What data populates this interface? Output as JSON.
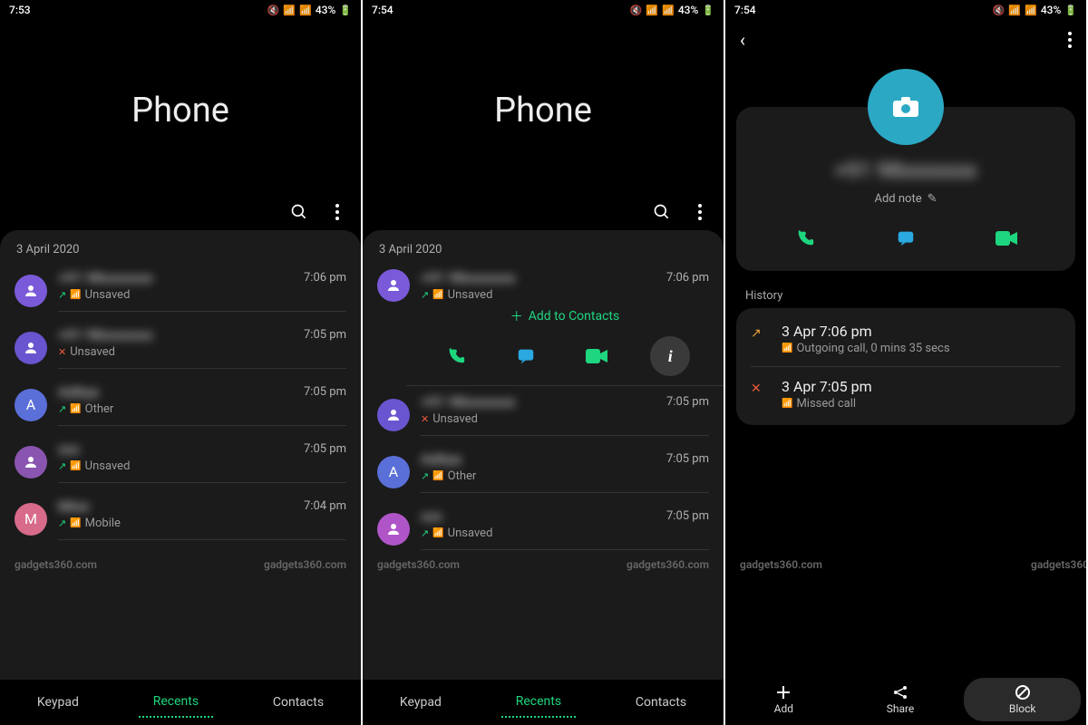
{
  "watermark": "gadgets360.com",
  "screen1": {
    "status": {
      "time": "7:53",
      "battery": "43%"
    },
    "title": "Phone",
    "date": "3 April 2020",
    "rows": [
      {
        "name": "+91 98xxxxxxx",
        "label": "Unsaved",
        "time": "7:06 pm",
        "color": "#7a5ad8",
        "type": "out",
        "initial": ""
      },
      {
        "name": "+91 98xxxxxxx",
        "label": "Unsaved",
        "time": "7:05 pm",
        "color": "#6a55d0",
        "type": "missed",
        "initial": ""
      },
      {
        "name": "Aditya",
        "label": "Other",
        "time": "7:05 pm",
        "color": "#5a6fd8",
        "type": "out",
        "initial": "A"
      },
      {
        "name": "xxx",
        "label": "Unsaved",
        "time": "7:05 pm",
        "color": "#8a55b0",
        "type": "out",
        "initial": ""
      },
      {
        "name": "Miss",
        "label": "Mobile",
        "time": "7:04 pm",
        "color": "#d86a8a",
        "type": "out",
        "initial": "M"
      }
    ],
    "nav": {
      "keypad": "Keypad",
      "recents": "Recents",
      "contacts": "Contacts"
    }
  },
  "screen2": {
    "status": {
      "time": "7:54",
      "battery": "43%"
    },
    "title": "Phone",
    "date": "3 April 2020",
    "expanded": {
      "name": "+91 98xxxxxxx",
      "label": "Unsaved",
      "time": "7:06 pm",
      "color": "#7a5ad8",
      "addContacts": "Add to Contacts"
    },
    "rows": [
      {
        "name": "+91 98xxxxxxx",
        "label": "Unsaved",
        "time": "7:05 pm",
        "color": "#6a55d0",
        "type": "missed",
        "initial": ""
      },
      {
        "name": "Aditya",
        "label": "Other",
        "time": "7:05 pm",
        "color": "#5a6fd8",
        "type": "out",
        "initial": "A"
      },
      {
        "name": "xxx",
        "label": "Unsaved",
        "time": "7:05 pm",
        "color": "#b055c8",
        "type": "out",
        "initial": ""
      }
    ],
    "nav": {
      "keypad": "Keypad",
      "recents": "Recents",
      "contacts": "Contacts"
    }
  },
  "screen3": {
    "status": {
      "time": "7:54",
      "battery": "43%"
    },
    "contactName": "+91 98xxxxxxx",
    "addNote": "Add note",
    "historyLabel": "History",
    "history": [
      {
        "time": "3 Apr 7:06 pm",
        "detail": "Outgoing call, 0 mins 35 secs",
        "type": "out"
      },
      {
        "time": "3 Apr 7:05 pm",
        "detail": "Missed call",
        "type": "missed"
      }
    ],
    "bottom": {
      "add": "Add",
      "share": "Share",
      "block": "Block"
    }
  }
}
